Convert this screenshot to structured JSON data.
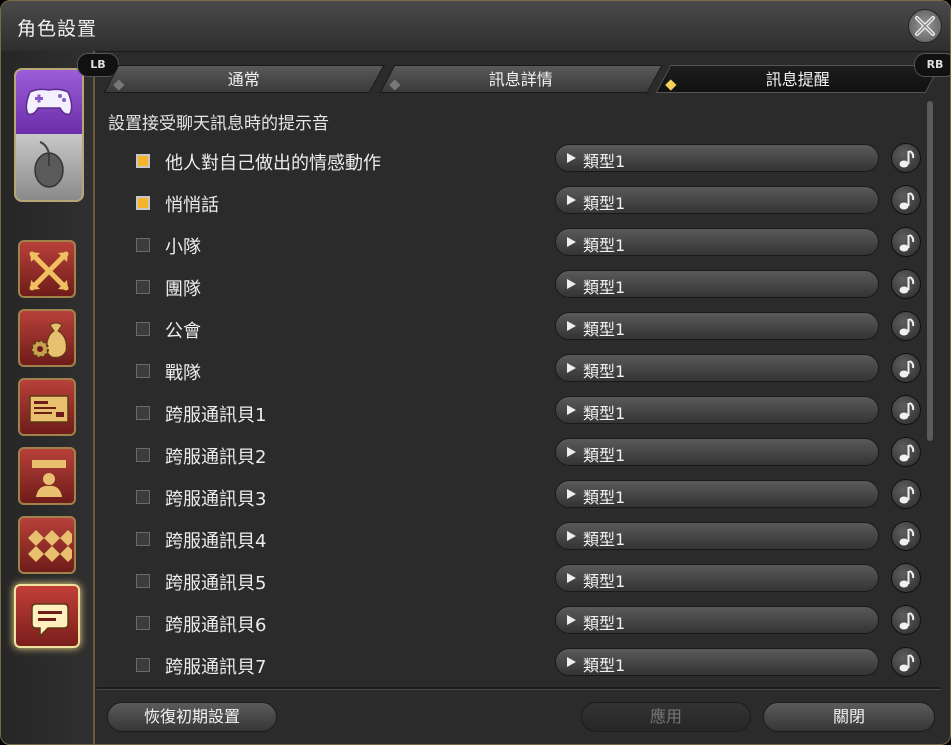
{
  "window": {
    "title": "角色設置"
  },
  "tabs": {
    "lb": "LB",
    "rb": "RB",
    "items": [
      {
        "label": "通常"
      },
      {
        "label": "訊息詳情"
      },
      {
        "label": "訊息提醒"
      }
    ]
  },
  "content": {
    "section_title": "設置接受聊天訊息時的提示音",
    "rows": [
      {
        "label": "他人對自己做出的情感動作",
        "checked": true,
        "sound": "類型1"
      },
      {
        "label": "悄悄話",
        "checked": true,
        "sound": "類型1"
      },
      {
        "label": "小隊",
        "checked": false,
        "sound": "類型1"
      },
      {
        "label": "團隊",
        "checked": false,
        "sound": "類型1"
      },
      {
        "label": "公會",
        "checked": false,
        "sound": "類型1"
      },
      {
        "label": "戰隊",
        "checked": false,
        "sound": "類型1"
      },
      {
        "label": "跨服通訊貝1",
        "checked": false,
        "sound": "類型1"
      },
      {
        "label": "跨服通訊貝2",
        "checked": false,
        "sound": "類型1"
      },
      {
        "label": "跨服通訊貝3",
        "checked": false,
        "sound": "類型1"
      },
      {
        "label": "跨服通訊貝4",
        "checked": false,
        "sound": "類型1"
      },
      {
        "label": "跨服通訊貝5",
        "checked": false,
        "sound": "類型1"
      },
      {
        "label": "跨服通訊貝6",
        "checked": false,
        "sound": "類型1"
      },
      {
        "label": "跨服通訊貝7",
        "checked": false,
        "sound": "類型1"
      }
    ]
  },
  "footer": {
    "reset": "恢復初期設置",
    "apply": "應用",
    "close": "關閉"
  },
  "colors": {
    "accent_gold": "#f4b52a",
    "tab_active_mark": "#f2d35a",
    "sidebar_red": "#b8403a",
    "gamepad_purple": "#9b5ed8"
  },
  "icons": {
    "close": "close-x-icon",
    "sidebar": [
      "gamepad-icon",
      "mouse-icon",
      "crossed-arrows-icon",
      "gear-bag-icon",
      "id-card-icon",
      "character-icon",
      "checker-pattern-icon",
      "chat-bubble-icon"
    ],
    "row_action": "music-note-icon"
  }
}
